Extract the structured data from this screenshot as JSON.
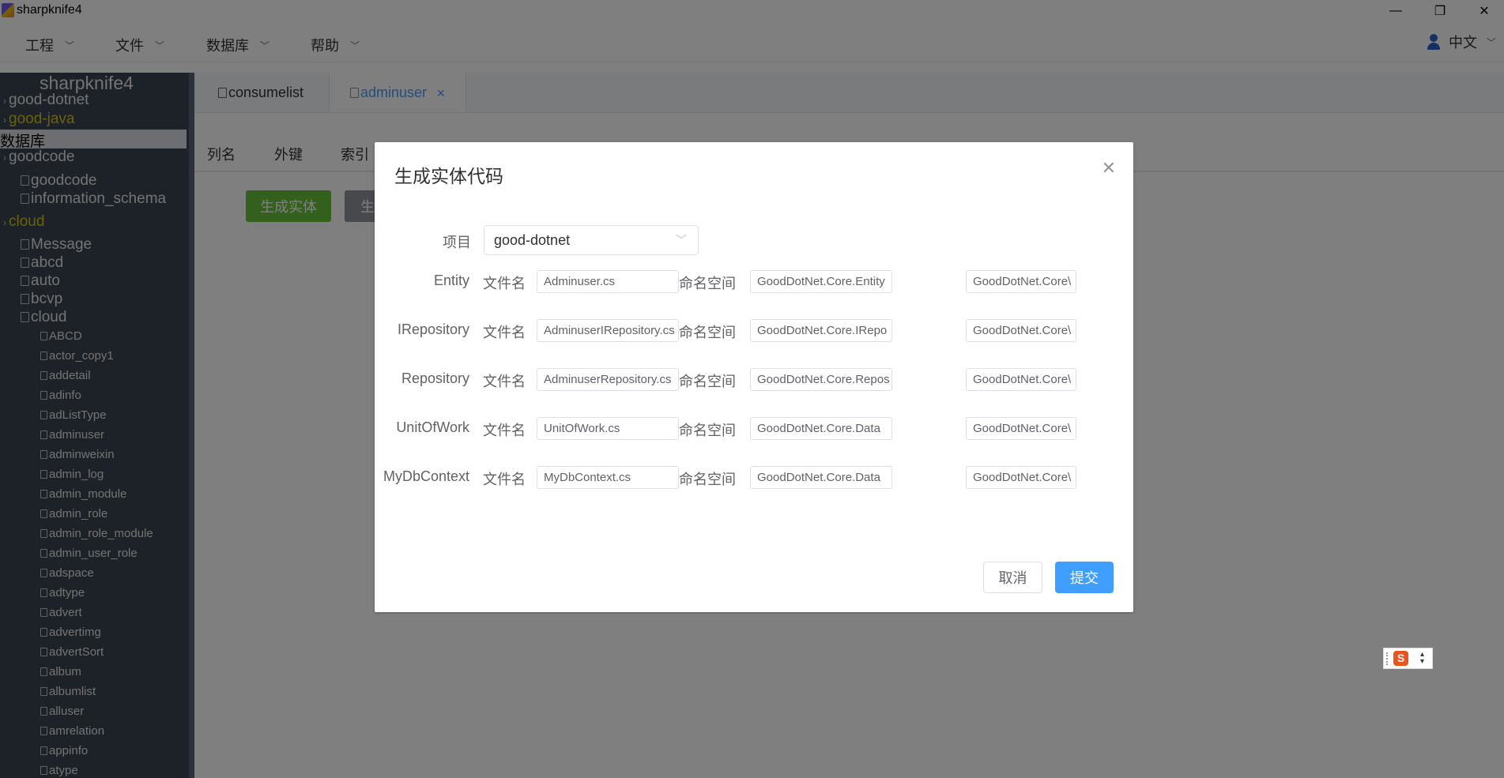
{
  "window": {
    "title": "sharpknife4",
    "minimize_glyph": "—",
    "restore_glyph": "❐",
    "close_glyph": "✕"
  },
  "menu": {
    "items": [
      "工程",
      "文件",
      "数据库",
      "帮助"
    ],
    "language": "中文"
  },
  "sidebar": {
    "title": "sharpknife4",
    "projects": [
      "good-dotnet",
      "good-java"
    ],
    "section": "数据库",
    "connections": [
      "goodcode",
      "cloud"
    ],
    "goodcode_dbs": [
      "goodcode",
      "information_schema"
    ],
    "cloud_dbs": [
      "Message",
      "abcd",
      "auto",
      "bcvp",
      "cloud"
    ],
    "cloud_tables": [
      "ABCD",
      "actor_copy1",
      "addetail",
      "adinfo",
      "adListType",
      "adminuser",
      "adminweixin",
      "admin_log",
      "admin_module",
      "admin_role",
      "admin_role_module",
      "admin_user_role",
      "adspace",
      "adtype",
      "advert",
      "advertimg",
      "advertSort",
      "album",
      "albumlist",
      "alluser",
      "amrelation",
      "appinfo",
      "atype"
    ]
  },
  "main": {
    "tabs": [
      {
        "label": "consumelist"
      },
      {
        "label": "adminuser"
      }
    ],
    "subtabs": [
      "列名",
      "外键",
      "索引"
    ],
    "generate_entity_button": "生成实体",
    "second_button": "生"
  },
  "dialog": {
    "title": "生成实体代码",
    "project_label": "项目",
    "project_value": "good-dotnet",
    "filename_label": "文件名",
    "namespace_label": "命名空间",
    "rows": [
      {
        "name": "Entity",
        "filename": "Adminuser.cs",
        "namespace": "GoodDotNet.Core.Entity",
        "path": "GoodDotNet.Core\\"
      },
      {
        "name": "IRepository",
        "filename": "AdminuserIRepository.cs",
        "namespace": "GoodDotNet.Core.IRepo",
        "path": "GoodDotNet.Core\\"
      },
      {
        "name": "Repository",
        "filename": "AdminuserRepository.cs",
        "namespace": "GoodDotNet.Core.Repos",
        "path": "GoodDotNet.Core\\"
      },
      {
        "name": "UnitOfWork",
        "filename": "UnitOfWork.cs",
        "namespace": "GoodDotNet.Core.Data",
        "path": "GoodDotNet.Core\\"
      },
      {
        "name": "MyDbContext",
        "filename": "MyDbContext.cs",
        "namespace": "GoodDotNet.Core.Data",
        "path": "GoodDotNet.Core\\"
      }
    ],
    "cancel": "取消",
    "submit": "提交"
  },
  "ime": {
    "label": "S"
  },
  "colors": {
    "sidebar_bg": "#3b4451",
    "highlight_yellow": "#d4c21a",
    "primary": "#409eff",
    "success": "#67c23a"
  }
}
